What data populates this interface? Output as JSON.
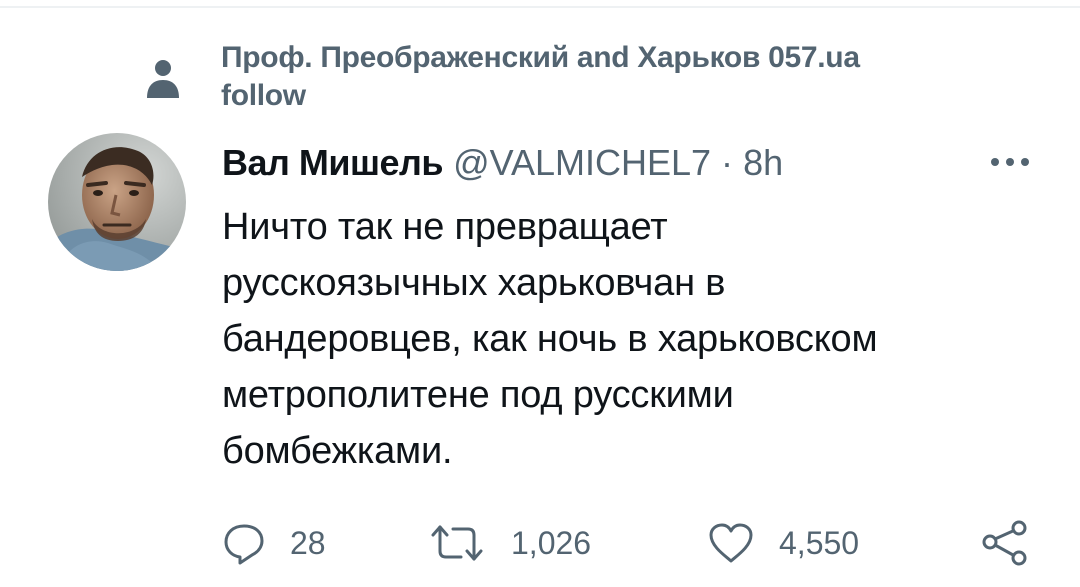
{
  "social_context": {
    "text": "Проф. Преображенский and Харьков 057.ua",
    "follow_label": "follow",
    "icon": "person-icon"
  },
  "tweet": {
    "author": {
      "display_name": "Вал Мишель",
      "handle": "@VALMICHEL7",
      "avatar": "avatar"
    },
    "separator": "·",
    "timestamp": "8h",
    "more_icon": "more-dots-icon",
    "text": "Ничто так не превращает\nрусскоязычных харьковчан в\nбандеровцев, как ночь в харьковском\nметрополитене под русскими\nбомбежками."
  },
  "actions": {
    "reply": {
      "icon": "reply-icon",
      "count": "28"
    },
    "retweet": {
      "icon": "retweet-icon",
      "count": "1,026"
    },
    "like": {
      "icon": "heart-icon",
      "count": "4,550"
    },
    "share": {
      "icon": "share-icon"
    }
  },
  "colors": {
    "primary_text": "#0f1419",
    "secondary_text": "#536471",
    "background": "#ffffff"
  }
}
